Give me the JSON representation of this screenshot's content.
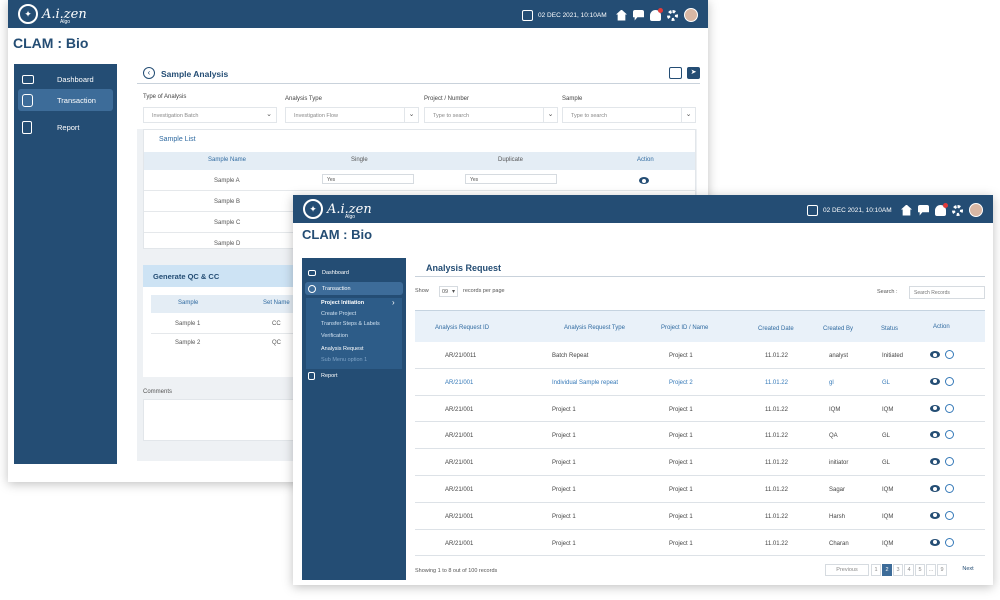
{
  "colors": {
    "brand": "#244d74",
    "accent": "#3579b8",
    "sidebar_active": "#3d6c99"
  },
  "common": {
    "logo_text": "A.i.zen",
    "logo_sub": "Algo",
    "datetime": "02 DEC 2021, 10:10AM",
    "app_title": "CLAM : Bio"
  },
  "back": {
    "sidebar": [
      {
        "label": "Dashboard",
        "icon": "laptop-icon"
      },
      {
        "label": "Transaction",
        "icon": "documents-icon"
      },
      {
        "label": "Report",
        "icon": "clipboard-icon"
      }
    ],
    "page_title": "Sample Analysis",
    "fields": [
      {
        "label": "Type of Analysis",
        "value": "Investigation Batch"
      },
      {
        "label": "Analysis Type",
        "value": "Investigation Flow"
      },
      {
        "label": "Project / Number",
        "value": "Type to search"
      },
      {
        "label": "Sample",
        "value": "Type to search"
      }
    ],
    "sample_list_title": "Sample List",
    "sample_headers": [
      "Sample Name",
      "Single",
      "Duplicate",
      "Action"
    ],
    "samples": [
      "Sample A",
      "Sample B",
      "Sample C",
      "Sample D"
    ],
    "sample_a_single": "Yes",
    "sample_a_duplicate": "Yes",
    "qc_title": "Generate QC & CC",
    "qc_headers": [
      "Sample",
      "Set Name"
    ],
    "qc_rows": [
      {
        "sample": "Sample 1",
        "set": "CC"
      },
      {
        "sample": "Sample 2",
        "set": "QC"
      }
    ],
    "comments_label": "Comments"
  },
  "front": {
    "sidebar": {
      "dashboard": "Dashboard",
      "transaction": "Transaction",
      "report": "Report",
      "submenu": [
        "Project Initiation",
        "Create Project",
        "Transfer Steps & Labels",
        "Verification",
        "Analysis Request",
        "Sub Menu option 1"
      ]
    },
    "page_title": "Analysis Request",
    "show_label": "Show",
    "show_value": "09",
    "records_label": "records per page",
    "search_label": "Search :",
    "search_placeholder": "Search Records",
    "headers": [
      "Analysis  Request ID",
      "Analysis Request Type",
      "Project ID / Name",
      "Created Date",
      "Created By",
      "Status",
      "Action"
    ],
    "rows": [
      {
        "id": "AR/21/0011",
        "type": "Batch Repeat",
        "project": "Project 1",
        "date": "11.01.22",
        "by": "analyst",
        "status": "Initiated"
      },
      {
        "id": "AR/21/001",
        "type": "Individual Sample repeat",
        "project": "Project 2",
        "date": "11.01.22",
        "by": "gl",
        "status": "GL"
      },
      {
        "id": "AR/21/001",
        "type": "Project 1",
        "project": "Project 1",
        "date": "11.01.22",
        "by": "IQM",
        "status": "IQM"
      },
      {
        "id": "AR/21/001",
        "type": "Project 1",
        "project": "Project 1",
        "date": "11.01.22",
        "by": "QA",
        "status": "GL"
      },
      {
        "id": "AR/21/001",
        "type": "Project 1",
        "project": "Project 1",
        "date": "11.01.22",
        "by": "initiator",
        "status": "GL"
      },
      {
        "id": "AR/21/001",
        "type": "Project 1",
        "project": "Project 1",
        "date": "11.01.22",
        "by": "Sagar",
        "status": "IQM"
      },
      {
        "id": "AR/21/001",
        "type": "Project 1",
        "project": "Project 1",
        "date": "11.01.22",
        "by": "Harsh",
        "status": "IQM"
      },
      {
        "id": "AR/21/001",
        "type": "Project 1",
        "project": "Project 1",
        "date": "11.01.22",
        "by": "Charan",
        "status": "IQM"
      }
    ],
    "footer": "Showing 1 to 8 out of 100 records",
    "pagination": {
      "previous": "Previous",
      "pages": [
        "1",
        "2",
        "3",
        "4",
        "5",
        "...",
        "9"
      ],
      "current": "2",
      "next": "Next"
    }
  }
}
